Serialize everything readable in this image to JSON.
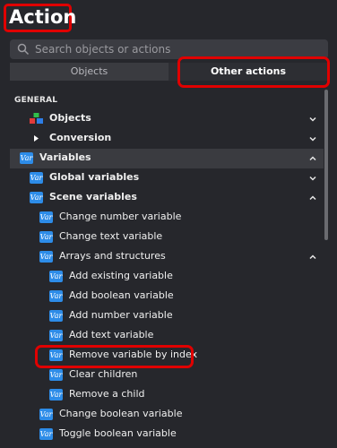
{
  "header": {
    "title": "Action"
  },
  "search": {
    "placeholder": "Search objects or actions"
  },
  "tabs": [
    {
      "label": "Objects"
    },
    {
      "label": "Other actions"
    }
  ],
  "section": {
    "label": "GENERAL"
  },
  "icon_text": "Var",
  "tree": [
    {
      "label": "Objects",
      "indent": 1,
      "icon": "objects-icon",
      "chevron": "down"
    },
    {
      "label": "Conversion",
      "indent": 1,
      "icon": "triangle-right",
      "chevron": "down"
    },
    {
      "label": "Variables",
      "indent": 0,
      "icon": "var",
      "chevron": "up",
      "selected": true
    },
    {
      "label": "Global variables",
      "indent": 1,
      "icon": "var",
      "chevron": "down"
    },
    {
      "label": "Scene variables",
      "indent": 1,
      "icon": "var",
      "chevron": "up"
    },
    {
      "label": "Change number variable",
      "indent": 2,
      "icon": "var",
      "chevron": null
    },
    {
      "label": "Change text variable",
      "indent": 2,
      "icon": "var",
      "chevron": null
    },
    {
      "label": "Arrays and structures",
      "indent": 2,
      "icon": "var",
      "chevron": "up"
    },
    {
      "label": "Add existing variable",
      "indent": 3,
      "icon": "var",
      "chevron": null
    },
    {
      "label": "Add boolean variable",
      "indent": 3,
      "icon": "var",
      "chevron": null
    },
    {
      "label": "Add number variable",
      "indent": 3,
      "icon": "var",
      "chevron": null
    },
    {
      "label": "Add text variable",
      "indent": 3,
      "icon": "var",
      "chevron": null
    },
    {
      "label": "Remove variable by index",
      "indent": 3,
      "icon": "var",
      "chevron": null
    },
    {
      "label": "Clear children",
      "indent": 3,
      "icon": "var",
      "chevron": null
    },
    {
      "label": "Remove a child",
      "indent": 3,
      "icon": "var",
      "chevron": null
    },
    {
      "label": "Change boolean variable",
      "indent": 2,
      "icon": "var",
      "chevron": null
    },
    {
      "label": "Toggle boolean variable",
      "indent": 2,
      "icon": "var",
      "chevron": null
    }
  ],
  "colors": {
    "background": "#26272c",
    "accent_highlight": "#e00000",
    "var_icon": "#2d8ce8"
  }
}
